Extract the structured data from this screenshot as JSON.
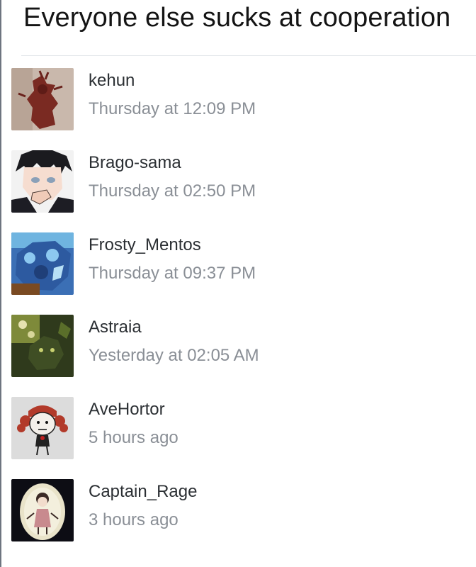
{
  "page": {
    "title": "Everyone else sucks at cooperation"
  },
  "participants": [
    {
      "name": "kehun",
      "time": "Thursday at 12:09 PM",
      "avatar_icon": "avatar-dark-red-figure"
    },
    {
      "name": "Brago-sama",
      "time": "Thursday at 02:50 PM",
      "avatar_icon": "avatar-anime-boy"
    },
    {
      "name": "Frosty_Mentos",
      "time": "Thursday at 09:37 PM",
      "avatar_icon": "avatar-blue-creature"
    },
    {
      "name": "Astraia",
      "time": "Yesterday at 02:05 AM",
      "avatar_icon": "avatar-green-forest"
    },
    {
      "name": "AveHortor",
      "time": "5 hours ago",
      "avatar_icon": "avatar-red-pigtails-girl"
    },
    {
      "name": "Captain_Rage",
      "time": "3 hours ago",
      "avatar_icon": "avatar-girl-in-oval"
    }
  ],
  "colors": {
    "title": "#141414",
    "username": "#2b2f33",
    "timestamp": "#8a8f96",
    "divider": "#e3e6ea"
  }
}
